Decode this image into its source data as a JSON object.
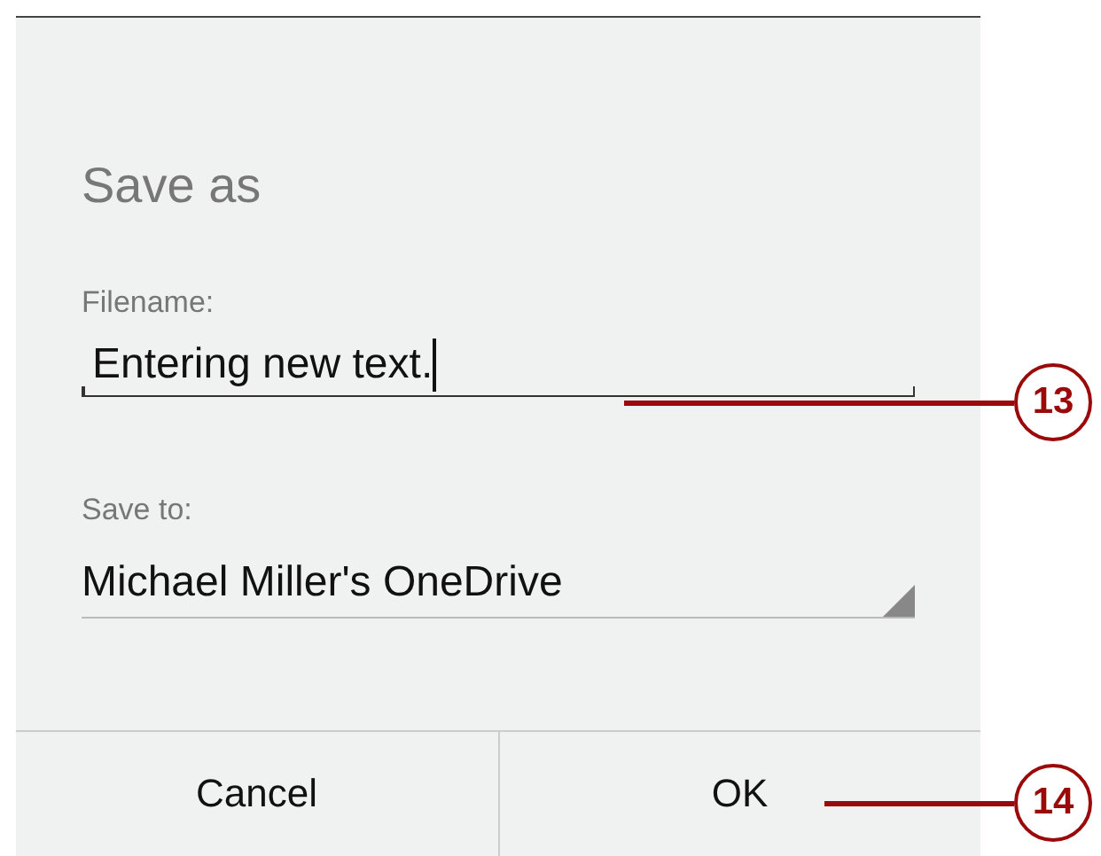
{
  "dialog": {
    "title": "Save as",
    "filename": {
      "label": "Filename:",
      "value": "Entering new text.",
      "focused": true
    },
    "save_to": {
      "label": "Save to:",
      "value": "Michael Miller's OneDrive"
    },
    "buttons": [
      "Cancel",
      "OK"
    ]
  },
  "callouts": [
    "13",
    "14"
  ]
}
